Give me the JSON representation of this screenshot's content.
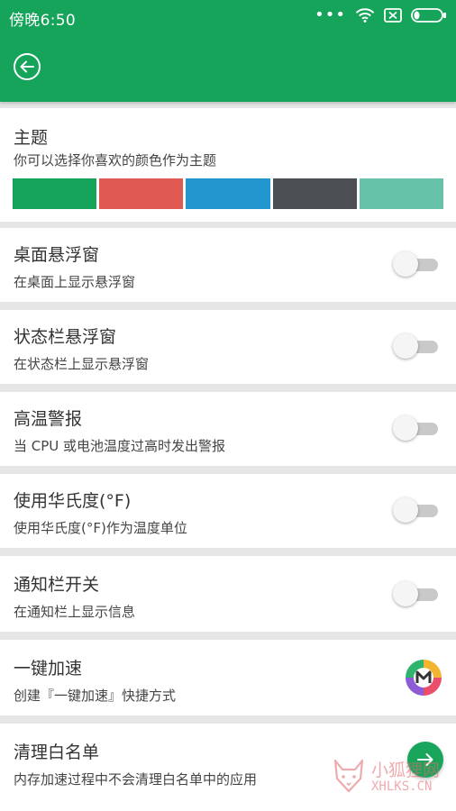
{
  "status_bar": {
    "time": "傍晚6:50",
    "icons": [
      "more-dots-icon",
      "wifi-icon",
      "no-sim-icon",
      "battery-icon"
    ]
  },
  "header": {
    "back_icon": "back-arrow-icon",
    "color": "#16a35a"
  },
  "theme": {
    "title": "主题",
    "subtitle": "你可以选择你喜欢的颜色作为主题",
    "swatches": [
      "#16a35a",
      "#de5a52",
      "#2196cf",
      "#4b4e52",
      "#66c3a9"
    ]
  },
  "settings": [
    {
      "title": "桌面悬浮窗",
      "subtitle": "在桌面上显示悬浮窗",
      "control": "toggle",
      "on": false
    },
    {
      "title": "状态栏悬浮窗",
      "subtitle": "在状态栏上显示悬浮窗",
      "control": "toggle",
      "on": false
    },
    {
      "title": "高温警报",
      "subtitle": "当 CPU 或电池温度过高时发出警报",
      "control": "toggle",
      "on": false
    },
    {
      "title": "使用华氏度(°F)",
      "subtitle": "使用华氏度(°F)作为温度单位",
      "control": "toggle",
      "on": false
    },
    {
      "title": "通知栏开关",
      "subtitle": "在通知栏上显示信息",
      "control": "toggle",
      "on": false
    },
    {
      "title": "一键加速",
      "subtitle": "创建『一键加速』快捷方式",
      "control": "app-icon"
    },
    {
      "title": "清理白名单",
      "subtitle": "内存加速过程中不会清理白名单中的应用",
      "control": "arrow-button"
    }
  ],
  "watermark": {
    "line1": "小狐狸网",
    "line2": "XHLKS.CN"
  }
}
